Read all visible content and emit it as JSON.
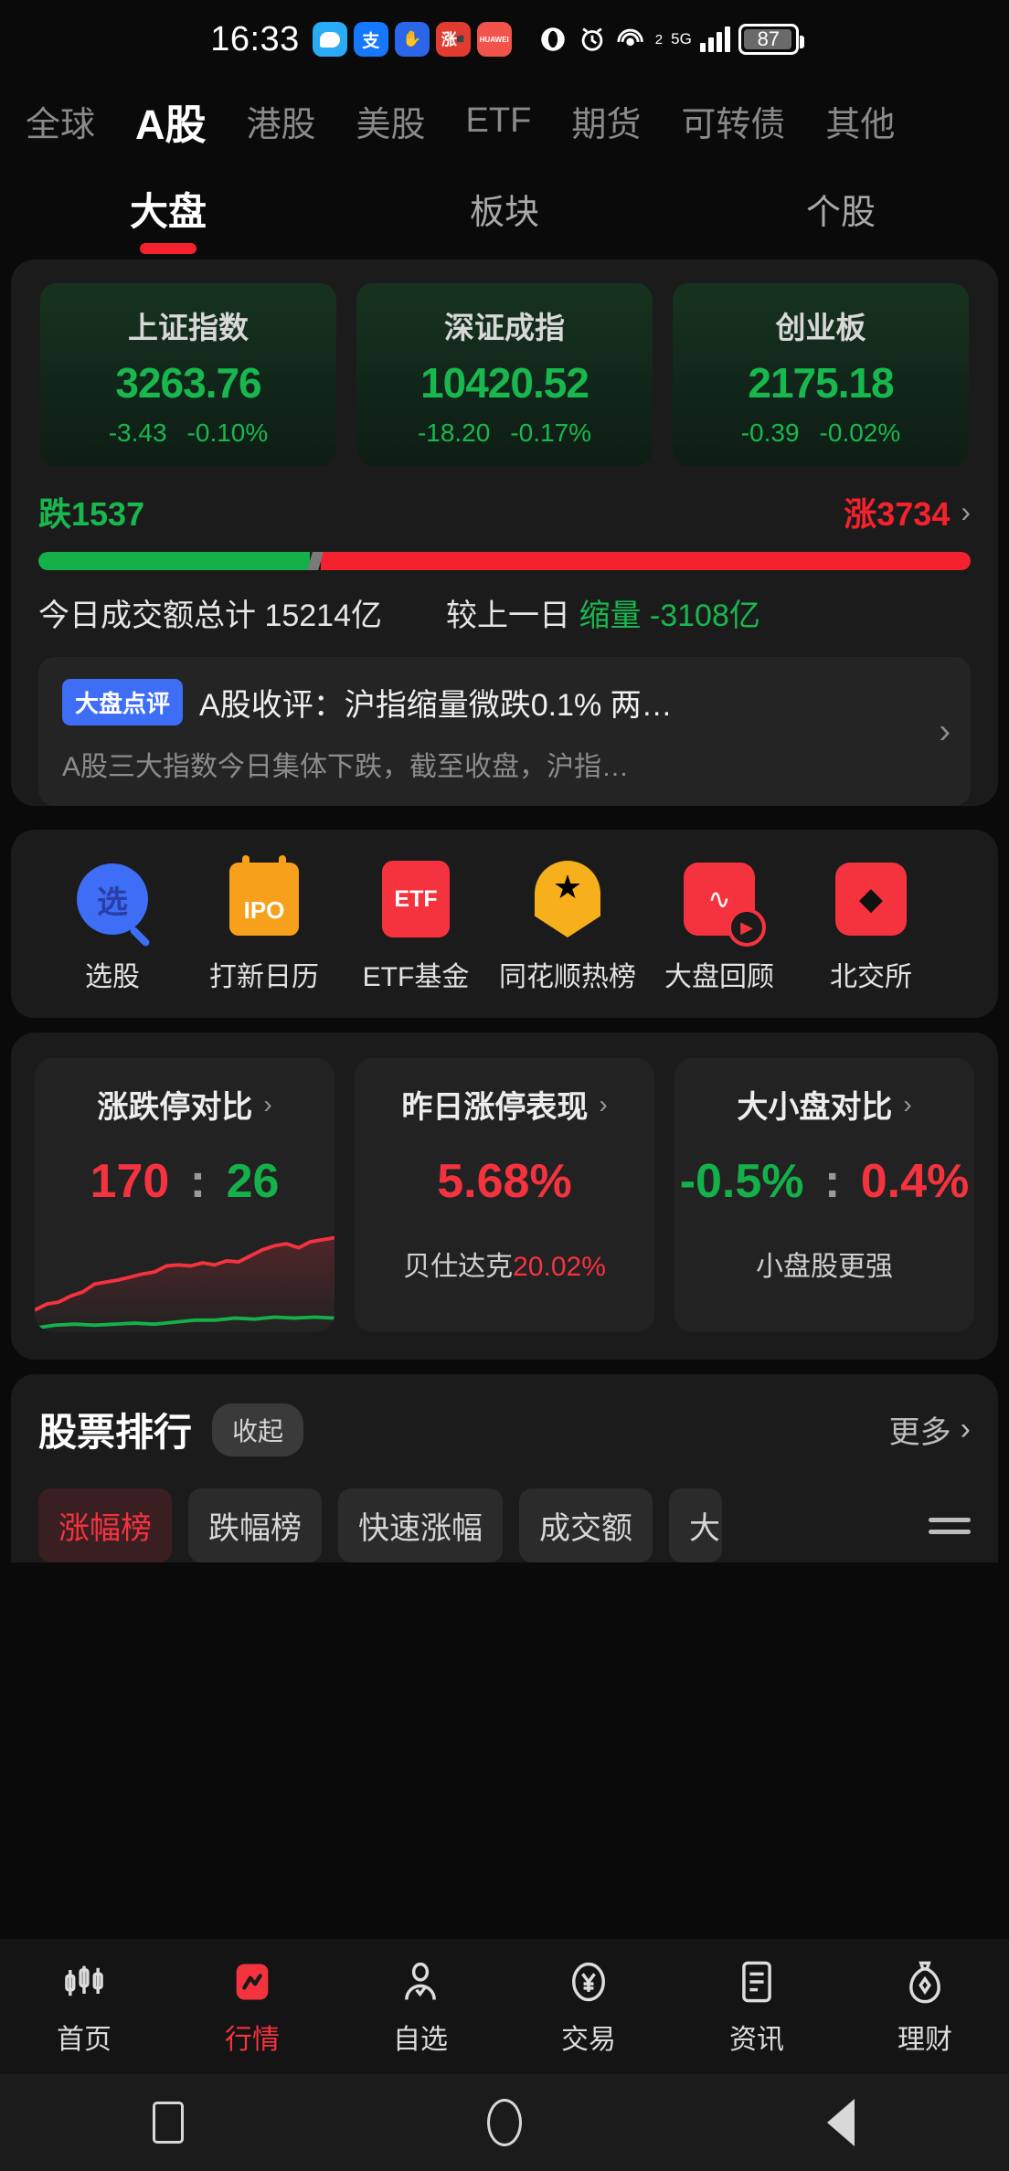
{
  "status_bar": {
    "time": "16:33",
    "battery_level": "87",
    "network": "5G",
    "signal_sup": "2",
    "app_icons": [
      "wechat-icon",
      "alipay-icon",
      "blue-app-icon",
      "zhang-app-icon",
      "huawei-app-icon"
    ],
    "system_icons": [
      "eye-icon",
      "alarm-icon",
      "hotspot-icon",
      "signal-icon",
      "battery-icon"
    ]
  },
  "market_tabs": [
    {
      "label": "全球",
      "active": false
    },
    {
      "label": "A股",
      "active": true
    },
    {
      "label": "港股",
      "active": false
    },
    {
      "label": "美股",
      "active": false
    },
    {
      "label": "ETF",
      "active": false
    },
    {
      "label": "期货",
      "active": false
    },
    {
      "label": "可转债",
      "active": false
    },
    {
      "label": "其他",
      "active": false
    }
  ],
  "sub_tabs": [
    {
      "label": "大盘",
      "active": true
    },
    {
      "label": "板块",
      "active": false
    },
    {
      "label": "个股",
      "active": false
    }
  ],
  "indices": [
    {
      "name": "上证指数",
      "price": "3263.76",
      "change": "-3.43",
      "change_pct": "-0.10%"
    },
    {
      "name": "深证成指",
      "price": "10420.52",
      "change": "-18.20",
      "change_pct": "-0.17%"
    },
    {
      "name": "创业板",
      "price": "2175.18",
      "change": "-0.39",
      "change_pct": "-0.02%"
    }
  ],
  "breadth": {
    "down_label": "跌1537",
    "up_label": "涨3734",
    "down_count": 1537,
    "up_count": 3734,
    "chevron": "›"
  },
  "turnover": {
    "today_label": "今日成交额总计 15214亿",
    "compare_prefix": "较上一日",
    "compare_state": "缩量",
    "compare_value": "-3108亿"
  },
  "news": {
    "badge": "大盘点评",
    "title": "A股收评：沪指缩量微跌0.1% 两…",
    "summary": "A股三大指数今日集体下跌，截至收盘，沪指…",
    "arrow": "›"
  },
  "quick_actions": [
    {
      "label": "选股",
      "icon": "stock-picker-icon",
      "glyph": "选"
    },
    {
      "label": "打新日历",
      "icon": "ipo-calendar-icon",
      "glyph": "IPO"
    },
    {
      "label": "ETF基金",
      "icon": "etf-fund-icon",
      "glyph": "ETF"
    },
    {
      "label": "同花顺热榜",
      "icon": "hot-list-star-icon",
      "glyph": "★"
    },
    {
      "label": "大盘回顾",
      "icon": "market-review-icon",
      "glyph": "∿"
    },
    {
      "label": "北交所",
      "icon": "beijing-exchange-icon",
      "glyph": "◆"
    }
  ],
  "stat_cards": [
    {
      "title": "涨跌停对比",
      "chevron": "›",
      "value_a": "170",
      "separator": ":",
      "value_b": "26",
      "value_a_color": "red",
      "value_b_color": "green",
      "sub": "",
      "has_spark": true
    },
    {
      "title": "昨日涨停表现",
      "chevron": "›",
      "value_a": "5.68%",
      "separator": "",
      "value_b": "",
      "value_a_color": "red",
      "value_b_color": "",
      "sub_name": "贝仕达克",
      "sub_value": "20.02%",
      "has_spark": false
    },
    {
      "title": "大小盘对比",
      "chevron": "›",
      "value_a": "-0.5%",
      "separator": ":",
      "value_b": "0.4%",
      "value_a_color": "green",
      "value_b_color": "red",
      "sub": "小盘股更强",
      "has_spark": false
    }
  ],
  "ranking": {
    "title": "股票排行",
    "collapse_label": "收起",
    "more_label": "更多",
    "more_chevron": "›",
    "chips": [
      {
        "label": "涨幅榜",
        "active": true
      },
      {
        "label": "跌幅榜",
        "active": false
      },
      {
        "label": "快速涨幅",
        "active": false
      },
      {
        "label": "成交额",
        "active": false
      },
      {
        "label": "大",
        "active": false
      }
    ],
    "menu_icon": "hamburger-menu-icon"
  },
  "bottom_nav": [
    {
      "label": "首页",
      "icon": "candlestick-icon",
      "active": false
    },
    {
      "label": "行情",
      "icon": "quotes-icon",
      "active": true
    },
    {
      "label": "自选",
      "icon": "watchlist-person-icon",
      "active": false
    },
    {
      "label": "交易",
      "icon": "trade-yuan-icon",
      "active": false
    },
    {
      "label": "资讯",
      "icon": "news-doc-icon",
      "active": false
    },
    {
      "label": "理财",
      "icon": "wealth-bag-icon",
      "active": false
    }
  ],
  "android_nav": [
    "recents-square-icon",
    "home-circle-icon",
    "back-triangle-icon"
  ],
  "colors": {
    "up_red": "#f5333f",
    "down_green": "#14b14a",
    "accent_blue": "#3d6ef5",
    "background": "#0a0a0a",
    "panel": "#1b1b1b"
  }
}
